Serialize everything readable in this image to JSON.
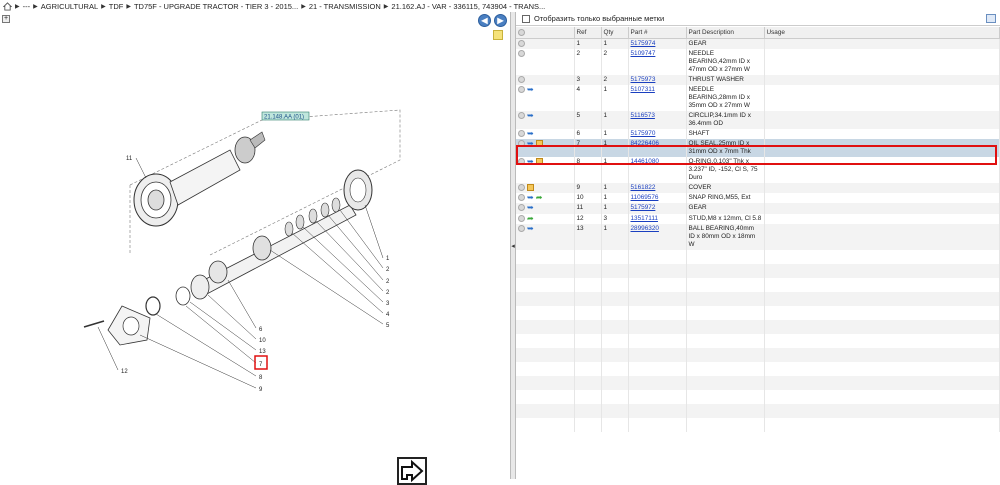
{
  "breadcrumb": {
    "items": [
      "---",
      "AGRICULTURAL",
      "TDF",
      "TD75F - UPGRADE TRACTOR - TIER 3 - 2015...",
      "21 - TRANSMISSION",
      "21.162.AJ - VAR - 336115, 743904 - TRANS..."
    ]
  },
  "diagram": {
    "ref_label": "21.148.AA (01)",
    "callouts": [
      "11",
      "1",
      "2",
      "2",
      "2",
      "3",
      "4",
      "5",
      "6",
      "10",
      "13",
      "7",
      "8",
      "9",
      "12"
    ]
  },
  "filter": {
    "label": "Отобразить только выбранные метки"
  },
  "table": {
    "columns": [
      "",
      "Ref",
      "Qty",
      "Part #",
      "Part Description",
      "Usage"
    ],
    "rows": [
      {
        "ref": "1",
        "qty": "1",
        "part": "5175974",
        "desc": "GEAR",
        "icons": [
          "circle"
        ]
      },
      {
        "ref": "2",
        "qty": "2",
        "part": "5109747",
        "desc": "NEEDLE BEARING,42mm ID x 47mm OD x 27mm W",
        "icons": [
          "circle"
        ]
      },
      {
        "ref": "3",
        "qty": "2",
        "part": "5175973",
        "desc": "THRUST WASHER",
        "icons": [
          "circle"
        ]
      },
      {
        "ref": "4",
        "qty": "1",
        "part": "5107311",
        "desc": "NEEDLE BEARING,28mm ID x 35mm OD x 27mm W",
        "icons": [
          "circle",
          "arrow"
        ]
      },
      {
        "ref": "5",
        "qty": "1",
        "part": "5116573",
        "desc": "CIRCLIP,34.1mm ID x 36.4mm OD",
        "icons": [
          "circle",
          "arrow"
        ]
      },
      {
        "ref": "6",
        "qty": "1",
        "part": "5175970",
        "desc": "SHAFT",
        "icons": [
          "circle",
          "arrow"
        ]
      },
      {
        "ref": "7",
        "qty": "1",
        "part": "84226406",
        "desc": "OIL SEAL,25mm ID x 31mm OD x 7mm Thk",
        "icons": [
          "circle",
          "arrow",
          "box"
        ]
      },
      {
        "ref": "8",
        "qty": "1",
        "part": "14461080",
        "desc": "O-RING,0.103\" Thk x 3.237\" ID, -152, Cl S, 75 Duro",
        "icons": [
          "circle",
          "arrow",
          "box"
        ]
      },
      {
        "ref": "9",
        "qty": "1",
        "part": "5161822",
        "desc": "COVER",
        "icons": [
          "circle",
          "box"
        ]
      },
      {
        "ref": "10",
        "qty": "1",
        "part": "11069576",
        "desc": "SNAP RING,M55, Ext",
        "icons": [
          "circle",
          "arrow",
          "green"
        ]
      },
      {
        "ref": "11",
        "qty": "1",
        "part": "5175972",
        "desc": "GEAR",
        "icons": [
          "circle",
          "arrow"
        ]
      },
      {
        "ref": "12",
        "qty": "3",
        "part": "13517111",
        "desc": "STUD,M8 x 12mm, Cl 5.8",
        "icons": [
          "circle",
          "green"
        ]
      },
      {
        "ref": "13",
        "qty": "1",
        "part": "28996320",
        "desc": "BALL BEARING,40mm ID x 80mm OD x 18mm W",
        "icons": [
          "circle",
          "arrow"
        ]
      }
    ]
  },
  "colors": {
    "selected_row": "#c8d7e4",
    "highlight_outline": "#e01010",
    "link": "#1a3fc0",
    "nav_button": "#4a7fc1"
  }
}
